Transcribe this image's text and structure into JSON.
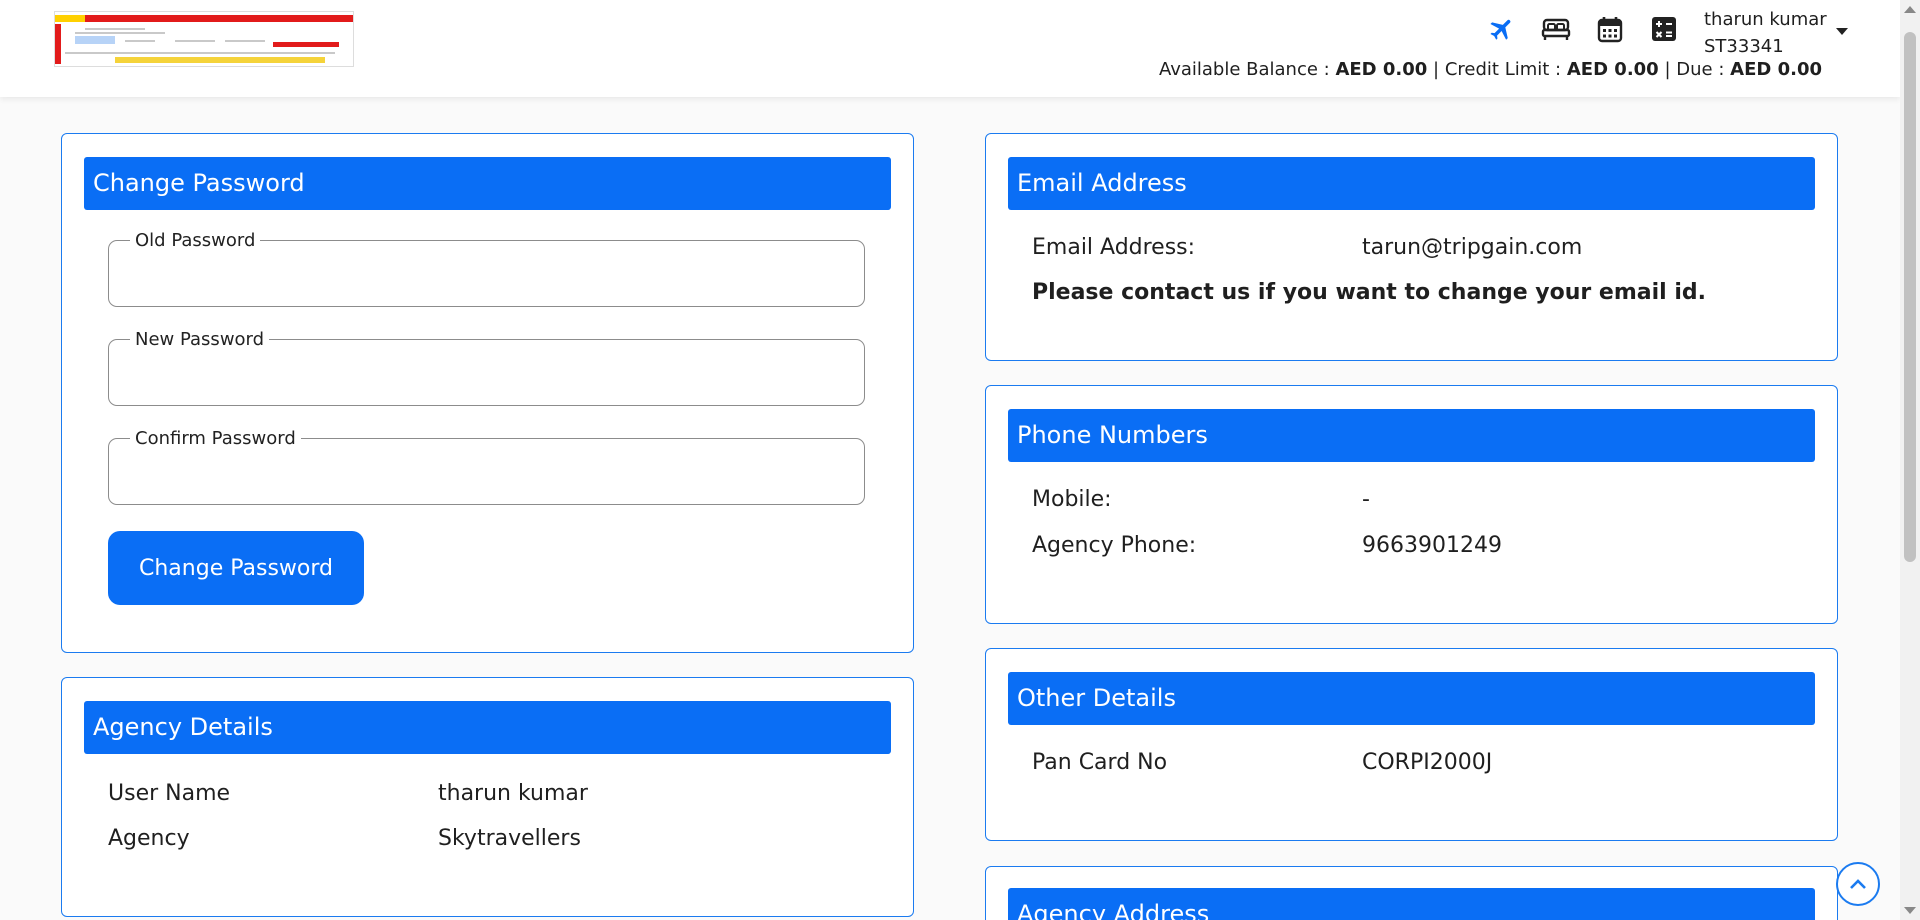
{
  "header": {
    "user_name": "tharun kumar",
    "user_id": "ST33341",
    "balance_label": "Available Balance :",
    "balance_value": "AED 0.00",
    "credit_label": "Credit Limit :",
    "credit_value": "AED 0.00",
    "due_label": "Due :",
    "due_value": "AED 0.00",
    "separator": "|",
    "icons": [
      "flight-icon",
      "hotel-bed-icon",
      "calendar-icon",
      "calculator-icon"
    ],
    "accent_color": "#0a6ef5"
  },
  "change_password": {
    "title": "Change Password",
    "old_password_label": "Old Password",
    "new_password_label": "New Password",
    "confirm_password_label": "Confirm Password",
    "old_password_value": "",
    "new_password_value": "",
    "confirm_password_value": "",
    "submit_label": "Change Password"
  },
  "agency_details": {
    "title": "Agency Details",
    "rows": [
      {
        "label": "User Name",
        "value": "tharun kumar"
      },
      {
        "label": "Agency",
        "value": "Skytravellers"
      }
    ]
  },
  "email": {
    "title": "Email Address",
    "label": "Email Address:",
    "value": "tarun@tripgain.com",
    "note": "Please contact us if you want to change your email id."
  },
  "phones": {
    "title": "Phone Numbers",
    "rows": [
      {
        "label": "Mobile:",
        "value": "-"
      },
      {
        "label": "Agency Phone:",
        "value": "9663901249"
      }
    ]
  },
  "other_details": {
    "title": "Other Details",
    "rows": [
      {
        "label": "Pan Card No",
        "value": "CORPI2000J"
      }
    ]
  },
  "agency_address": {
    "title": "Agency Address"
  }
}
